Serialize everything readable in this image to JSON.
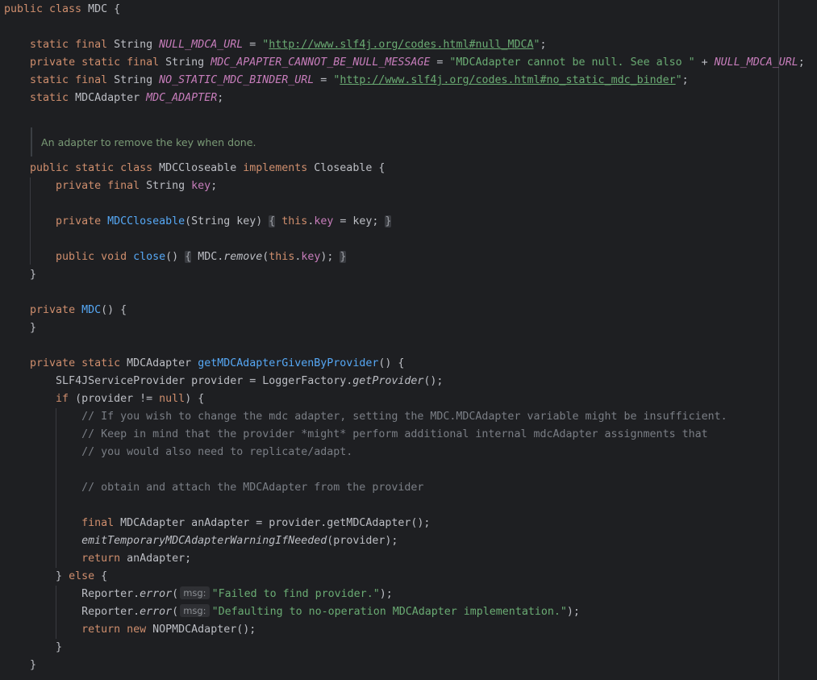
{
  "editor": {
    "language": "Java",
    "class_name": "MDC",
    "javadoc": "An adapter to remove the key when done.",
    "inlay_hint_label": "msg:",
    "code": {
      "l1_class_decl": [
        "public class ",
        "MDC",
        " {"
      ],
      "l2": [
        "static final ",
        "String ",
        "NULL_MDCA_URL",
        " = ",
        "\"",
        "http://www.slf4j.org/codes.html#null_MDCA",
        "\"",
        ";"
      ],
      "l3": [
        "private static final ",
        "String ",
        "MDC_APAPTER_CANNOT_BE_NULL_MESSAGE",
        " = ",
        "\"MDCAdapter cannot be null. See also \"",
        " + ",
        "NULL_MDCA_URL",
        ";"
      ],
      "l4": [
        "static final ",
        "String ",
        "NO_STATIC_MDC_BINDER_URL",
        " = ",
        "\"",
        "http://www.slf4j.org/codes.html#no_static_mdc_binder",
        "\"",
        ";"
      ],
      "l5": [
        "static ",
        "MDCAdapter ",
        "MDC_ADAPTER",
        ";"
      ],
      "l6": [
        "public static class ",
        "MDCCloseable ",
        "implements ",
        "Closeable {"
      ],
      "l7": [
        "private final ",
        "String ",
        "key",
        ";"
      ],
      "l8": [
        "private ",
        "MDCCloseable",
        "(String key) ",
        "{",
        " ",
        "this",
        ".",
        "key",
        " = key; ",
        "}"
      ],
      "l9": [
        "public void ",
        "close",
        "() ",
        "{",
        " MDC.",
        "remove",
        "(",
        "this",
        ".",
        "key",
        "); ",
        "}"
      ],
      "l10": "}",
      "l11": [
        "private ",
        "MDC",
        "() {"
      ],
      "l12": "}",
      "l13": [
        "private static ",
        "MDCAdapter ",
        "getMDCAdapterGivenByProvider",
        "() {"
      ],
      "l14": [
        "SLF4JServiceProvider provider = LoggerFactory.",
        "getProvider",
        "();"
      ],
      "l15": [
        "if ",
        "(provider != ",
        "null",
        ") {"
      ],
      "l16": "// If you wish to change the mdc adapter, setting the MDC.MDCAdapter variable might be insufficient.",
      "l17": "// Keep in mind that the provider *might* perform additional internal mdcAdapter assignments that",
      "l18": "// you would also need to replicate/adapt.",
      "l19": "// obtain and attach the MDCAdapter from the provider",
      "l20": [
        "final ",
        "MDCAdapter anAdapter = provider.getMDCAdapter();"
      ],
      "l21": [
        "emitTemporaryMDCAdapterWarningIfNeeded",
        "(provider);"
      ],
      "l22": [
        "return ",
        "anAdapter;"
      ],
      "l23": [
        "} ",
        "else ",
        "{"
      ],
      "l24": [
        "Reporter.",
        "error",
        "(",
        "\"Failed to find provider.\"",
        ");"
      ],
      "l25": [
        "Reporter.",
        "error",
        "(",
        "\"Defaulting to no-operation MDCAdapter implementation.\"",
        ");"
      ],
      "l26": [
        "return new ",
        "NOPMDCAdapter();"
      ],
      "l27": "}",
      "l28": "}"
    }
  }
}
